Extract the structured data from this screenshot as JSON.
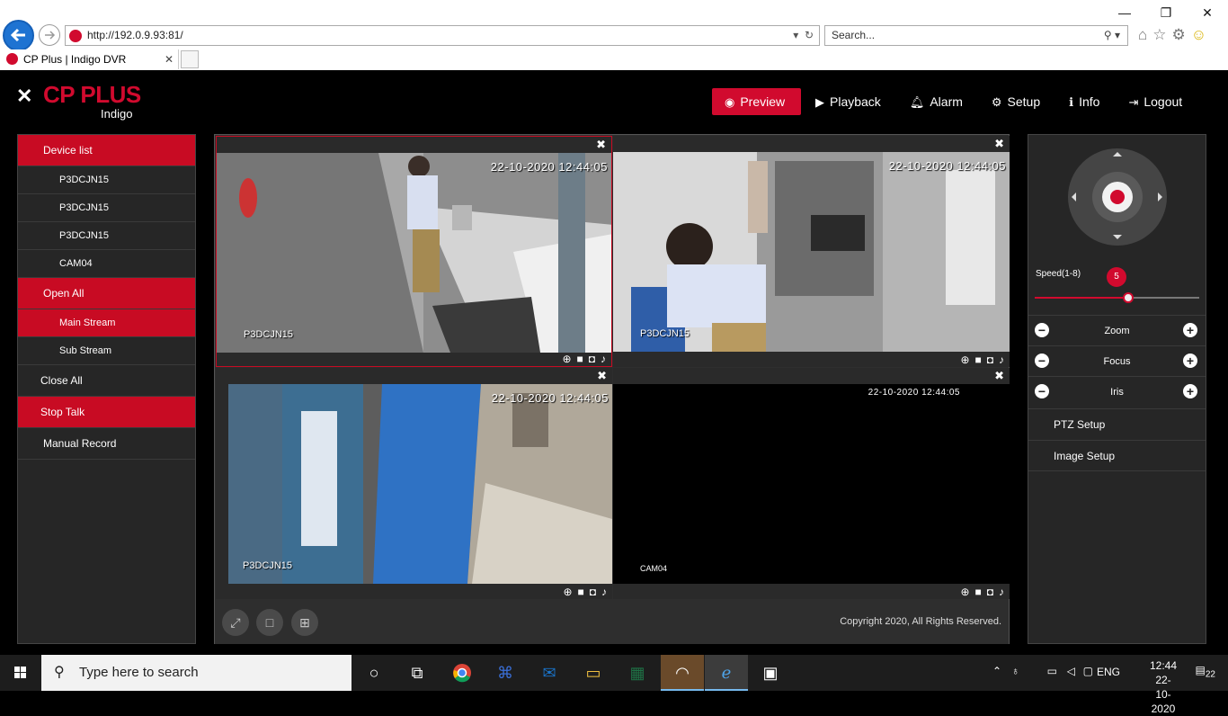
{
  "browser": {
    "url": "http://192.0.9.93:81/",
    "search_placeholder": "Search...",
    "tab_title": "CP Plus | Indigo DVR"
  },
  "header": {
    "brand": "CP PLUS",
    "sub": "Indigo",
    "nav": [
      {
        "label": "Preview",
        "icon": "eye-icon",
        "active": true
      },
      {
        "label": "Playback",
        "icon": "play-icon"
      },
      {
        "label": "Alarm",
        "icon": "bell-icon"
      },
      {
        "label": "Setup",
        "icon": "gear-icon"
      },
      {
        "label": "Info",
        "icon": "info-icon"
      },
      {
        "label": "Logout",
        "icon": "logout-icon"
      }
    ]
  },
  "sidebar": {
    "device_list": "Device list",
    "devices": [
      "P3DCJN15",
      "P3DCJN15",
      "P3DCJN15",
      "CAM04"
    ],
    "open_all": "Open All",
    "main_stream": "Main Stream",
    "sub_stream": "Sub Stream",
    "close_all": "Close All",
    "stop_talk": "Stop Talk",
    "manual_record": "Manual Record"
  },
  "cells": [
    {
      "timestamp": "22-10-2020 12:44:05",
      "camera": "P3DCJN15"
    },
    {
      "timestamp": "22-10-2020 12:44:05",
      "camera": "P3DCJN15"
    },
    {
      "timestamp": "22-10-2020 12:44:05",
      "camera": "P3DCJN15"
    },
    {
      "timestamp": "22-10-2020 12:44:05",
      "camera": "CAM04"
    }
  ],
  "footer": {
    "copyright": "Copyright 2020, All Rights Reserved."
  },
  "ptz": {
    "speed_label": "Speed(1-8)",
    "speed_value": "5",
    "speed_fraction": 0.57,
    "zoom": "Zoom",
    "focus": "Focus",
    "iris": "Iris",
    "ptz_setup": "PTZ Setup",
    "image_setup": "Image Setup"
  },
  "taskbar": {
    "search_placeholder": "Type here to search",
    "lang": "ENG",
    "time": "12:44",
    "date": "22-10-2020",
    "notifications": "22"
  },
  "colors": {
    "accent": "#d10a2e",
    "panel": "#262626"
  }
}
